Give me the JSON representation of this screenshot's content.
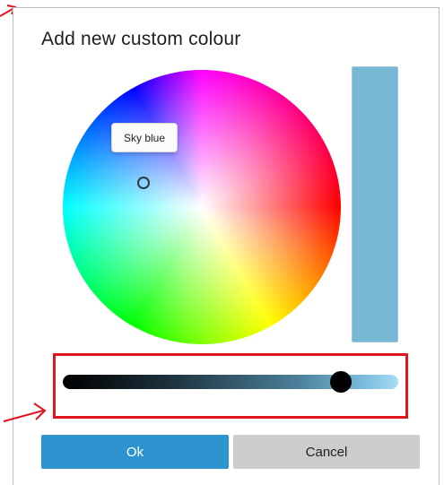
{
  "dialog": {
    "title": "Add new custom colour"
  },
  "color_picker": {
    "tooltip": "Sky blue",
    "preview_color": "#79b7d6"
  },
  "brightness_slider": {
    "value_fraction": 0.83,
    "end_color": "#a7ddf7"
  },
  "buttons": {
    "ok_label": "Ok",
    "cancel_label": "Cancel"
  },
  "annotation": {
    "highlight_color": "#e0151d"
  }
}
